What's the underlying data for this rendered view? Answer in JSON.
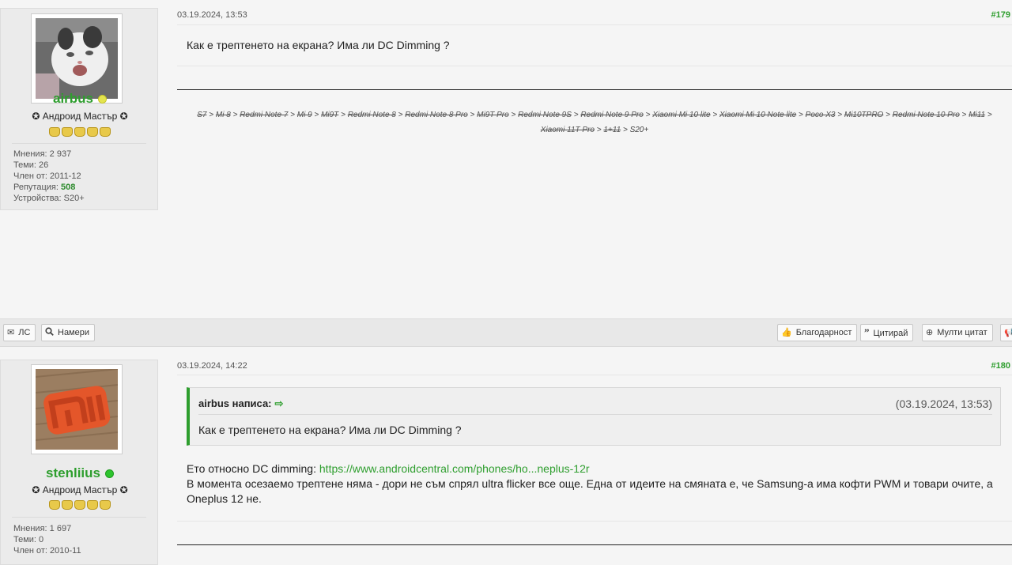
{
  "post1": {
    "username": "airbus",
    "status_color": "#e4e44e",
    "rank": "✪ Андроид Мастър ✪",
    "stars": 5,
    "stats": {
      "posts_label": "Мнения:",
      "posts": "2 937",
      "threads_label": "Теми:",
      "threads": "26",
      "member_label": "Член от:",
      "member_since": "2011-12",
      "rep_label": "Репутация:",
      "reputation": "508",
      "devices_label": "Устройства:",
      "devices": "S20+"
    },
    "date": "03.19.2024, 13:53",
    "number": "#179",
    "message": "Как е трептенето на екрана? Има ли DC Dimming ?",
    "signature": {
      "line1": [
        {
          "text": "S7",
          "strike": true
        },
        {
          "text": " > ",
          "strike": false
        },
        {
          "text": "Mi 8",
          "strike": true
        },
        {
          "text": " > ",
          "strike": false
        },
        {
          "text": "Redmi Note 7",
          "strike": true
        },
        {
          "text": " > ",
          "strike": false
        },
        {
          "text": "Mi 9",
          "strike": true
        },
        {
          "text": " > ",
          "strike": false
        },
        {
          "text": "Mi9T",
          "strike": true
        },
        {
          "text": " > ",
          "strike": false
        },
        {
          "text": "Redmi Note 8",
          "strike": true
        },
        {
          "text": " > ",
          "strike": false
        },
        {
          "text": "Redmi Note 8 Pro",
          "strike": true
        },
        {
          "text": " > ",
          "strike": false
        },
        {
          "text": "Mi9T Pro",
          "strike": true
        },
        {
          "text": " > ",
          "strike": false
        },
        {
          "text": "Redmi Note 9S",
          "strike": true
        },
        {
          "text": " > ",
          "strike": false
        },
        {
          "text": "Redmi Note 9 Pro",
          "strike": true
        },
        {
          "text": " > ",
          "strike": false
        },
        {
          "text": "Xiaomi Mi 10 lite",
          "strike": true
        },
        {
          "text": " > ",
          "strike": false
        },
        {
          "text": "Xiaomi Mi 10 Note lite",
          "strike": true
        },
        {
          "text": " >  ",
          "strike": false
        },
        {
          "text": "Poco X3",
          "strike": true
        },
        {
          "text": " > ",
          "strike": false
        },
        {
          "text": "Mi10TPRO",
          "strike": true
        },
        {
          "text": " > ",
          "strike": false
        },
        {
          "text": "Redmi Note 10 Pro",
          "strike": true
        },
        {
          "text": " > ",
          "strike": false
        },
        {
          "text": "Mi11",
          "strike": true
        },
        {
          "text": " >",
          "strike": false
        }
      ],
      "line2": [
        {
          "text": "Xiaomi 11T Pro",
          "strike": true
        },
        {
          "text": " > ",
          "strike": false
        },
        {
          "text": "1+11",
          "strike": true
        },
        {
          "text": " > S20+",
          "strike": false
        }
      ]
    }
  },
  "toolbar": {
    "pm": "ЛС",
    "find": "Намери",
    "thanks": "Благодарност",
    "quote": "Цитирай",
    "multiquote": "Мулти цитат"
  },
  "post2": {
    "username": "stenliius",
    "status_color": "#2ec42e",
    "rank": "✪ Андроид Мастър ✪",
    "stars": 5,
    "stats": {
      "posts_label": "Мнения:",
      "posts": "1 697",
      "threads_label": "Теми:",
      "threads": "0",
      "member_label": "Член от:",
      "member_since": "2010-11"
    },
    "date": "03.19.2024, 14:22",
    "number": "#180",
    "quote": {
      "author": "airbus написа:",
      "date": "(03.19.2024, 13:53)",
      "text": "Как е трептенето на екрана? Има ли DC Dimming ?"
    },
    "body_prefix": "Ето относно DC dimming: ",
    "link": "https://www.androidcentral.com/phones/ho...neplus-12r",
    "body_rest": "В момента осезаемо трептене няма - дори не съм спрял ultra flicker все още. Една от идеите на смяната е, че Samsung-а има кофти PWM и товари очите, а Oneplus 12 не."
  }
}
